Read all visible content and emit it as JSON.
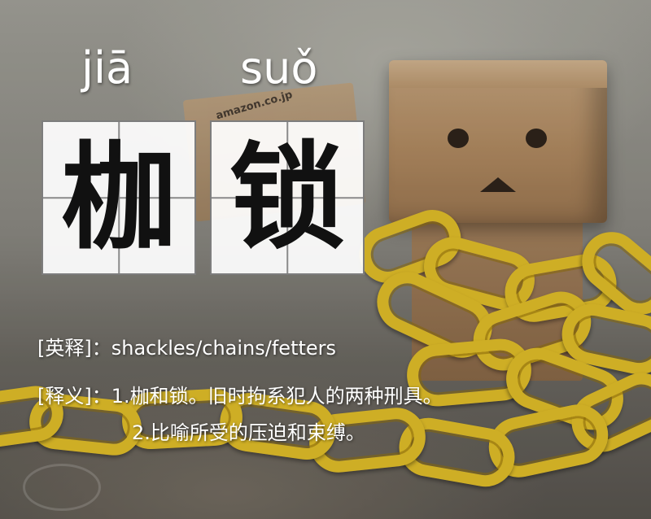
{
  "pinyin": [
    "jiā",
    "suǒ"
  ],
  "characters": [
    "枷",
    "锁"
  ],
  "english": {
    "label": "[英释]",
    "separator": "：",
    "value": "shackles/chains/fetters"
  },
  "definition": {
    "label": "[释义]",
    "separator": "：",
    "item1": "1.枷和锁。旧时拘系犯人的两种刑具。",
    "item2": "2.比喻所受的压迫和束缚。"
  },
  "background": {
    "box_label": "amazon.co.jp"
  },
  "colors": {
    "chain": "#e6c22a",
    "box": "#b48d63",
    "text": "#ffffff"
  }
}
